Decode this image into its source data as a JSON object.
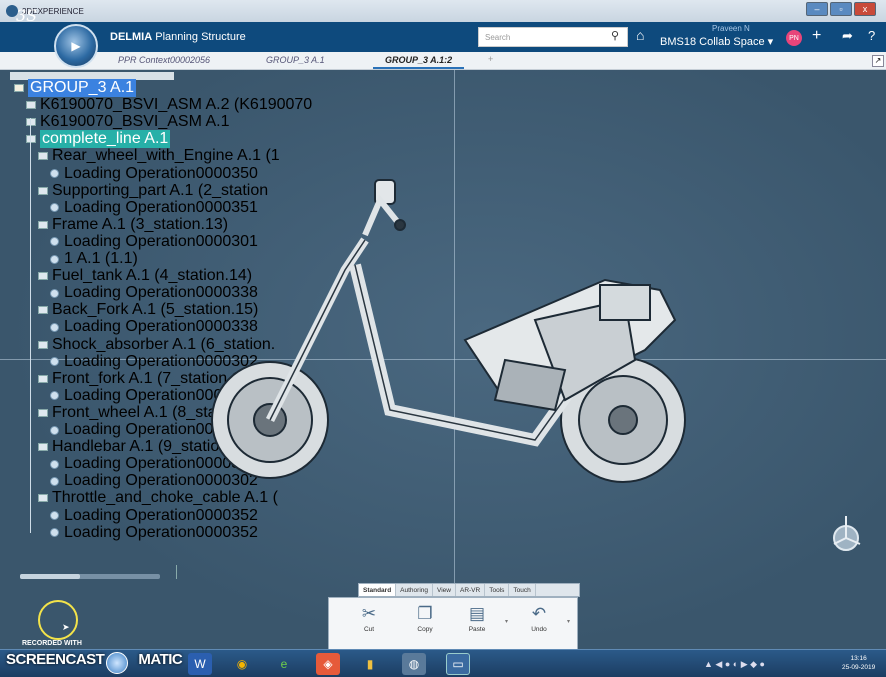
{
  "titlebar": {
    "app_name": "3DEXPERIENCE",
    "minimize": "–",
    "maximize": "▫",
    "close": "x"
  },
  "header": {
    "logo": "3S",
    "app_title_bold": "DELMIA",
    "app_title_rest": " Planning Structure",
    "search_placeholder": "Search",
    "user": "Praveen N",
    "collab_space": "BMS18 Collab Space",
    "avatar_text": "PN"
  },
  "tabs": [
    {
      "label": "PPR Context00002056",
      "active": false
    },
    {
      "label": "GROUP_3 A.1",
      "active": false
    },
    {
      "label": "GROUP_3 A.1:2",
      "active": true
    }
  ],
  "tab_add": "+",
  "tree": {
    "root": "GROUP_3 A.1",
    "nodes": [
      "K6190070_BSVI_ASM A.2 (K6190070",
      "K6190070_BSVI_ASM A.1",
      "complete_line A.1",
      "Rear_wheel_with_Engine A.1 (1",
      "Loading Operation0000350",
      "Supporting_part A.1 (2_station",
      "Loading Operation0000351",
      "Frame A.1 (3_station.13)",
      "Loading Operation0000301",
      "1 A.1 (1.1)",
      "Fuel_tank A.1 (4_station.14)",
      "Loading Operation0000338",
      "Back_Fork A.1 (5_station.15)",
      "Loading Operation0000338",
      "Shock_absorber A.1 (6_station.",
      "Loading Operation0000302",
      "Front_fork A.1 (7_station.17)",
      "Loading Operation0000352",
      "Front_wheel A.1 (8_station.18)",
      "Loading Operation0000352",
      "Handlebar A.1 (9_station.19)",
      "Loading Operation0000302",
      "Loading Operation0000302",
      "Throttle_and_choke_cable A.1 (",
      "Loading Operation0000352",
      "Loading Operation0000352"
    ]
  },
  "action_bar": {
    "tabs": [
      "Standard",
      "Authoring",
      "View",
      "AR-VR",
      "Tools",
      "Touch"
    ],
    "buttons": [
      {
        "label": "Cut",
        "icon": "scissors-icon"
      },
      {
        "label": "Copy",
        "icon": "copy-icon"
      },
      {
        "label": "Paste",
        "icon": "paste-icon"
      },
      {
        "label": "Undo",
        "icon": "undo-icon"
      }
    ]
  },
  "overlay": {
    "recorded_with": "RECORDED WITH"
  },
  "taskbar": {
    "brand_left": "SCREENCAST",
    "brand_right": "MATIC",
    "time": "13:16",
    "date": "25-09-2019"
  },
  "colors": {
    "header_bg": "#0e4a7d",
    "viewport_bg": "#3c5a72",
    "selection_blue": "#3b82e0",
    "selection_teal": "#27b0a8"
  }
}
